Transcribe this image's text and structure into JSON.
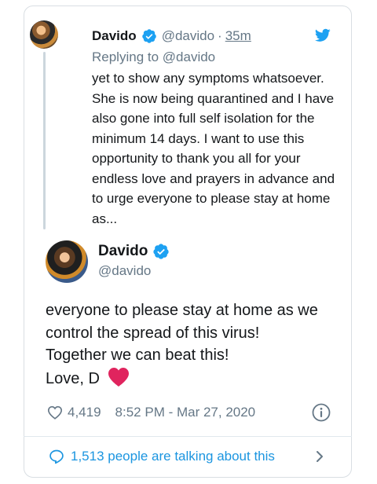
{
  "quoted_tweet": {
    "name": "Davido",
    "handle": "@davido",
    "separator": "·",
    "time": "35m",
    "replying_to": "Replying to @davido",
    "text": "yet to show any symptoms whatsoever. She is now being quarantined and I have also gone into full self isolation for the minimum 14 days. I want to use this opportunity to thank you all for your endless love and prayers in advance and to urge everyone to please stay at home as..."
  },
  "main_tweet": {
    "name": "Davido",
    "handle": "@davido",
    "lines": [
      "everyone to please stay at home as we control the spread of this virus!",
      "Together we can beat this!",
      "Love, D"
    ],
    "likes": "4,419",
    "timestamp": "8:52 PM - Mar 27, 2020"
  },
  "footer": {
    "talking": "1,513 people are talking about this"
  },
  "colors": {
    "verified": "#1da1f2",
    "link": "#1b95e0",
    "heart": "#e0245e",
    "secondary_text": "#657786"
  },
  "icons": {
    "verified": "verified-badge-icon",
    "bird": "twitter-bird-icon",
    "like": "heart-outline-icon",
    "info": "info-icon",
    "talk": "speech-bubble-icon",
    "chevron": "chevron-right-icon",
    "heart_emoji": "red-heart-emoji-icon"
  }
}
